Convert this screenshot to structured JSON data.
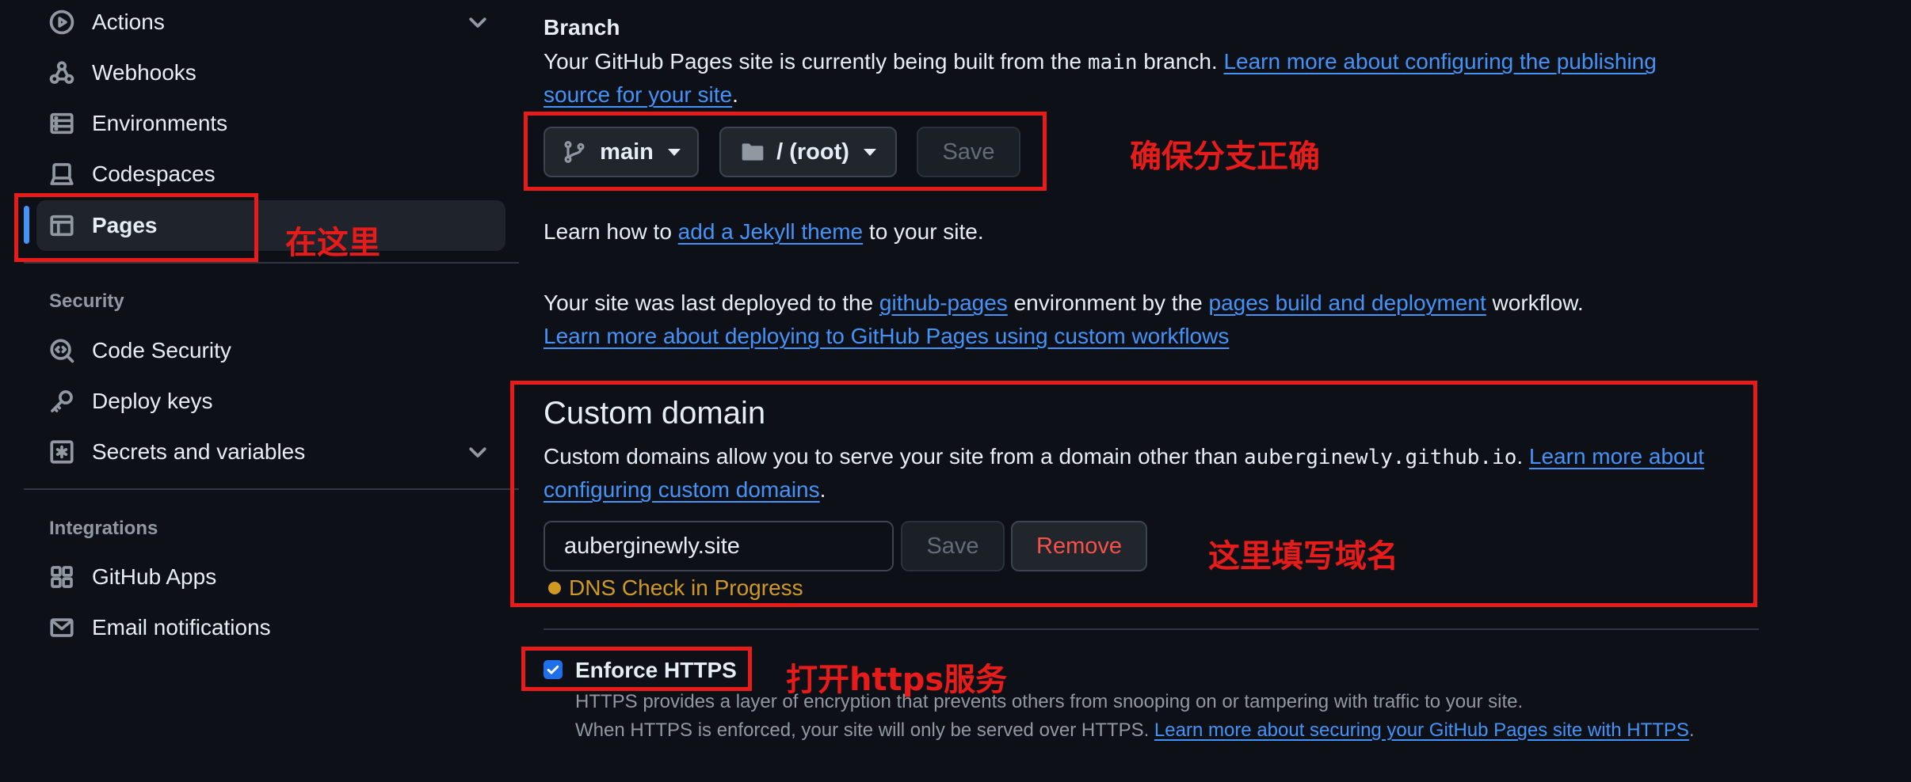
{
  "sidebar": {
    "items": [
      {
        "label": "Actions",
        "icon": "play-circle-icon",
        "chevron": true
      },
      {
        "label": "Webhooks",
        "icon": "webhook-icon"
      },
      {
        "label": "Environments",
        "icon": "server-icon"
      },
      {
        "label": "Codespaces",
        "icon": "codespaces-icon"
      },
      {
        "label": "Pages",
        "icon": "browser-icon",
        "active": true
      }
    ],
    "security_title": "Security",
    "security_items": [
      {
        "label": "Code Security",
        "icon": "codescan-icon"
      },
      {
        "label": "Deploy keys",
        "icon": "key-icon"
      },
      {
        "label": "Secrets and variables",
        "icon": "asterisk-icon",
        "chevron": true
      }
    ],
    "integrations_title": "Integrations",
    "integration_items": [
      {
        "label": "GitHub Apps",
        "icon": "apps-icon"
      },
      {
        "label": "Email notifications",
        "icon": "mail-icon"
      }
    ]
  },
  "branch": {
    "heading": "Branch",
    "desc_prefix": "Your GitHub Pages site is currently being built from the ",
    "branch_code": "main",
    "desc_mid": " branch. ",
    "learn_link_line1": "Learn more about configuring the publishing",
    "learn_link_line2": "source for your site",
    "period": ".",
    "branch_button": "main",
    "folder_button": "/ (root)",
    "save_button": "Save"
  },
  "jekyll": {
    "prefix": "Learn how to ",
    "link": "add a Jekyll theme",
    "suffix": " to your site."
  },
  "deploy": {
    "prefix": "Your site was last deployed to the ",
    "env_link": "github-pages",
    "mid": " environment by the ",
    "workflow_link": "pages build and deployment",
    "suffix": " workflow.",
    "learn_link": "Learn more about deploying to GitHub Pages using custom workflows"
  },
  "custom_domain": {
    "heading": "Custom domain",
    "desc_prefix": "Custom domains allow you to serve your site from a domain other than ",
    "domain_code": "auberginewly.github.io",
    "desc_sep": ". ",
    "learn_link_line1": "Learn more about",
    "learn_link_line2": "configuring custom domains",
    "period": ".",
    "input_value": "auberginewly.site",
    "save_button": "Save",
    "remove_button": "Remove",
    "dns_status": "DNS Check in Progress"
  },
  "https": {
    "label": "Enforce HTTPS",
    "checked": true,
    "desc_line1": "HTTPS provides a layer of encryption that prevents others from snooping on or tampering with traffic to your site.",
    "desc_line2_prefix": "When HTTPS is enforced, your site will only be served over HTTPS. ",
    "desc_link": "Learn more about securing your GitHub Pages site with HTTPS",
    "period": "."
  },
  "annotations": {
    "pages": "在这里",
    "branch": "确保分支正确",
    "domain": "这里填写域名",
    "https": "打开https服务"
  },
  "colors": {
    "background": "#0d1117",
    "link": "#4493f8",
    "annotation": "#e81b1b",
    "warning": "#d29922",
    "danger": "#f85149"
  }
}
